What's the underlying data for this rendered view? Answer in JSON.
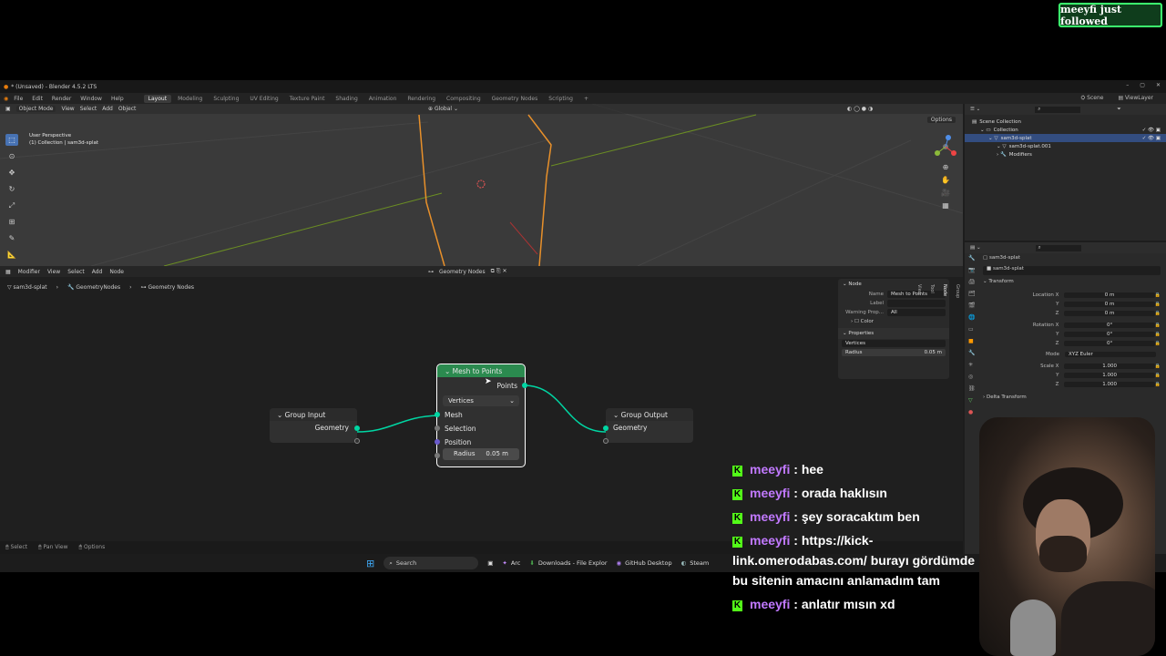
{
  "follow_alert": {
    "text": "meeyfi just followed"
  },
  "blender": {
    "title": "* (Unsaved) - Blender 4.5.2 LTS",
    "menus": [
      "File",
      "Edit",
      "Render",
      "Window",
      "Help"
    ],
    "workspaces": [
      "Layout",
      "Modeling",
      "Sculpting",
      "UV Editing",
      "Texture Paint",
      "Shading",
      "Animation",
      "Rendering",
      "Compositing",
      "Geometry Nodes",
      "Scripting"
    ],
    "active_workspace": "Layout",
    "scene": "Scene",
    "view_layer": "ViewLayer",
    "viewport": {
      "mode": "Object Mode",
      "menus": [
        "View",
        "Select",
        "Add",
        "Object"
      ],
      "transform": "Global",
      "options": "Options",
      "info_line1": "User Perspective",
      "info_line2": "(1) Collection | sam3d-splat"
    },
    "node_editor": {
      "editor": "Modifier",
      "menus": [
        "View",
        "Select",
        "Add",
        "Node"
      ],
      "tree_name": "Geometry Nodes",
      "breadcrumb": [
        "sam3d-splat",
        "GeometryNodes",
        "Geometry Nodes"
      ],
      "nodes": {
        "group_input": {
          "title": "Group Input",
          "output": "Geometry"
        },
        "mesh_to_points": {
          "title": "Mesh to Points",
          "output": "Points",
          "mode": "Vertices",
          "inputs": [
            "Mesh",
            "Selection",
            "Position"
          ],
          "radius_label": "Radius",
          "radius_value": "0.05 m"
        },
        "group_output": {
          "title": "Group Output",
          "input": "Geometry"
        }
      },
      "npanel": {
        "node_section": "Node",
        "name_label": "Name",
        "name_value": "Mesh to Points",
        "label_label": "Label",
        "warning_label": "Warning Prop...",
        "warning_value": "All",
        "color_label": "Color",
        "properties_section": "Properties",
        "mode_value": "Vertices",
        "radius_label": "Radius",
        "radius_value": "0.05 m",
        "tabs": [
          "Group",
          "Node",
          "Tool",
          "View"
        ]
      }
    },
    "status": {
      "select": "Select",
      "pan": "Pan View",
      "options": "Options"
    },
    "outliner": {
      "items": [
        {
          "label": "Scene Collection",
          "indent": 0
        },
        {
          "label": "Collection",
          "indent": 1
        },
        {
          "label": "sam3d-splat",
          "indent": 2
        },
        {
          "label": "sam3d-splat.001",
          "indent": 3
        },
        {
          "label": "Modifiers",
          "indent": 3
        }
      ]
    },
    "properties": {
      "object": "sam3d-splat",
      "object_name": "sam3d-splat",
      "transform_section": "Transform",
      "delta_section": "Delta Transform",
      "location": [
        {
          "l": "Location X",
          "v": "0 m"
        },
        {
          "l": "Y",
          "v": "0 m"
        },
        {
          "l": "Z",
          "v": "0 m"
        }
      ],
      "rotation": [
        {
          "l": "Rotation X",
          "v": "0°"
        },
        {
          "l": "Y",
          "v": "0°"
        },
        {
          "l": "Z",
          "v": "0°"
        }
      ],
      "mode_label": "Mode",
      "mode_value": "XYZ Euler",
      "scale": [
        {
          "l": "Scale X",
          "v": "1.000"
        },
        {
          "l": "Y",
          "v": "1.000"
        },
        {
          "l": "Z",
          "v": "1.000"
        }
      ]
    }
  },
  "taskbar": {
    "search": "Search",
    "apps": [
      "Arc",
      "Downloads - File Explor",
      "GitHub Desktop",
      "Steam"
    ]
  },
  "chat": [
    {
      "user": "meeyfi",
      "text": "hee"
    },
    {
      "user": "meeyfi",
      "text": "orada haklısın"
    },
    {
      "user": "meeyfi",
      "text": "şey soracaktım ben"
    },
    {
      "user": "meeyfi",
      "text": "https://kick-link.omerodabas.com/ burayı gördümde bu sitenin amacını anlamadım tam"
    },
    {
      "user": "meeyfi",
      "text": "anlatır mısın xd"
    }
  ],
  "colors": {
    "geometry_socket": "#00d6a3",
    "node_header_green": "#2b8a4f",
    "kick_green": "#53fc18",
    "chat_user": "#c179ff"
  }
}
